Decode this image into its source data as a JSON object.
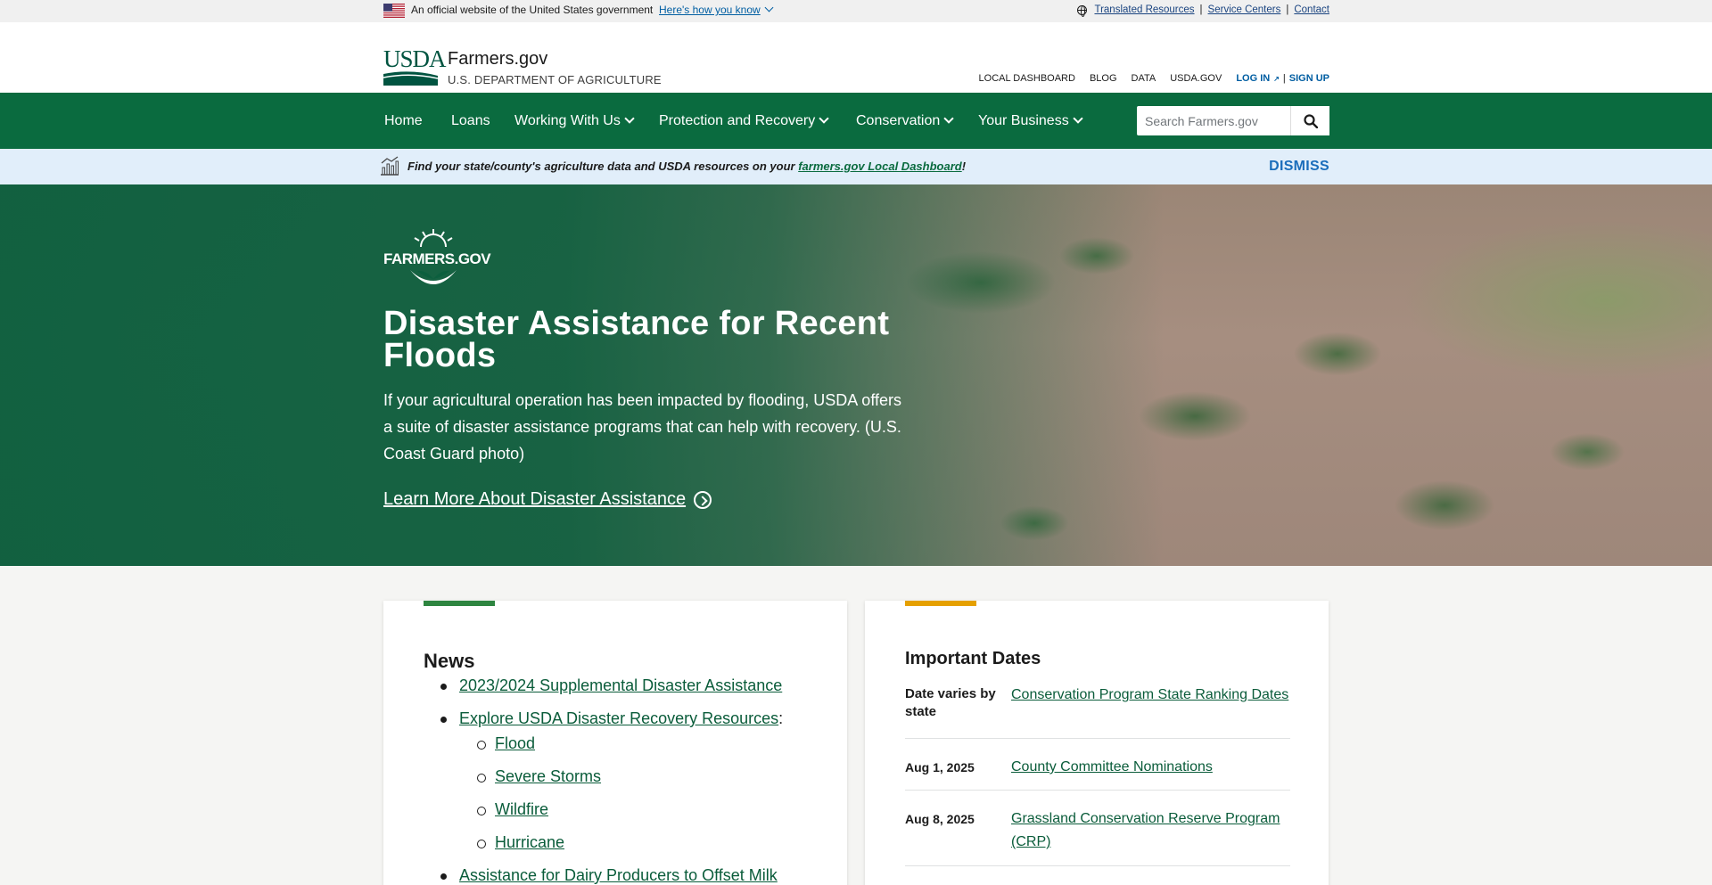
{
  "govbanner": {
    "official": "An official website of the United States government",
    "how_know": "Here's how you know",
    "links": [
      "Translated Resources",
      "Service Centers",
      "Contact"
    ],
    "separator": "|"
  },
  "header": {
    "logo_text": "USDA",
    "site_title": "Farmers.gov",
    "site_subtitle": "U.S. DEPARTMENT OF AGRICULTURE",
    "utility_links": [
      "LOCAL DASHBOARD",
      "BLOG",
      "DATA",
      "USDA.GOV"
    ],
    "login": "LOG IN",
    "signup": "SIGN UP",
    "separator": "|"
  },
  "nav": {
    "items": [
      {
        "label": "Home",
        "dropdown": false
      },
      {
        "label": "Loans",
        "dropdown": false
      },
      {
        "label": "Working With Us",
        "dropdown": true
      },
      {
        "label": "Protection and Recovery",
        "dropdown": true
      },
      {
        "label": "Conservation",
        "dropdown": true
      },
      {
        "label": "Your Business",
        "dropdown": true
      }
    ],
    "search_placeholder": "Search Farmers.gov"
  },
  "alert": {
    "prefix": "Find your state/county's agriculture data and USDA resources on your ",
    "link": "farmers.gov Local Dashboard",
    "suffix": "!",
    "dismiss": "DISMISS"
  },
  "hero": {
    "brand": "FARMERS.GOV",
    "title": "Disaster Assistance for Recent Floods",
    "lead": "If your agricultural operation has been impacted by flooding, USDA offers a suite of disaster assistance programs that can help with recovery. (U.S. Coast Guard photo)",
    "cta": "Learn More About Disaster Assistance"
  },
  "news": {
    "heading": "News",
    "items": [
      {
        "label": "2023/2024 Supplemental Disaster Assistance"
      },
      {
        "label": "Explore USDA Disaster Recovery Resources",
        "suffix": ":"
      },
      {
        "label": "Flood"
      },
      {
        "label": "Severe Storms"
      },
      {
        "label": "Wildfire"
      },
      {
        "label": "Hurricane"
      },
      {
        "label": "Assistance for Dairy Producers to Offset Milk"
      }
    ]
  },
  "important_dates": {
    "heading": "Important Dates",
    "rows": [
      {
        "date": "Date varies by state",
        "title": "Conservation Program State Ranking Dates"
      },
      {
        "date": "Aug 1, 2025",
        "title": "County Committee Nominations"
      },
      {
        "date": "Aug 8, 2025",
        "title": "Grassland Conservation Reserve Program (CRP)"
      }
    ]
  },
  "colors": {
    "nav_green": "#0a6b3f",
    "link_green": "#0a5c3a",
    "alert_bg": "#e1eefa",
    "dismiss_blue": "#1a6dbb",
    "news_accent": "#2e8540",
    "dates_accent": "#e5a000"
  }
}
